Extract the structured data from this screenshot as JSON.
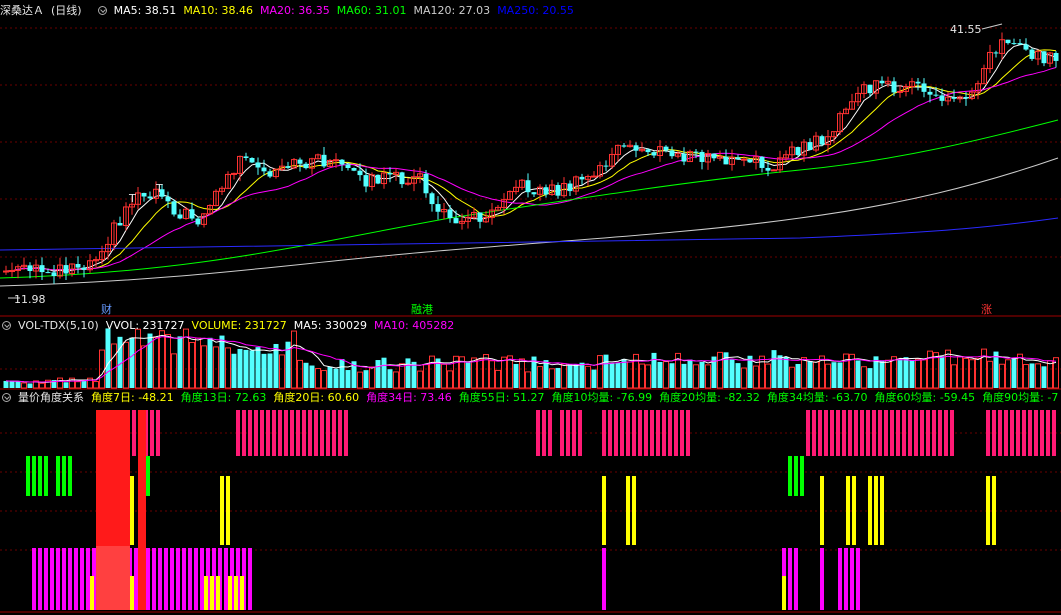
{
  "stock": {
    "name": "深桑达Ａ",
    "period": "(日线)"
  },
  "ma_header": [
    {
      "label": "MA5: 38.51",
      "color": "#ffffff"
    },
    {
      "label": "MA10: 38.46",
      "color": "#ffff00"
    },
    {
      "label": "MA20: 36.35",
      "color": "#ff00ff"
    },
    {
      "label": "MA60: 31.01",
      "color": "#00ff00"
    },
    {
      "label": "MA120: 27.03",
      "color": "#cccccc"
    },
    {
      "label": "MA250: 20.55",
      "color": "#0000ff"
    }
  ],
  "price_marks": {
    "high": "41.55",
    "low": "11.98",
    "tick_T1": "T",
    "tick_T2": "T"
  },
  "event_tags": [
    {
      "label": "财",
      "color": "#6699ff"
    },
    {
      "label": "融港",
      "color": "#00ff00"
    },
    {
      "label": "涨",
      "color": "#ff3333"
    }
  ],
  "vol_header": [
    {
      "label": "VOL-TDX(5,10)",
      "color": "#e6e6e6"
    },
    {
      "label": "VVOL: 231727",
      "color": "#ffffff"
    },
    {
      "label": "VOLUME: 231727",
      "color": "#ffff00"
    },
    {
      "label": "MA5: 330029",
      "color": "#ffffff"
    },
    {
      "label": "MA10: 405282",
      "color": "#ff00ff"
    }
  ],
  "ind_header": [
    {
      "label": "量价角度关系",
      "color": "#e6e6e6"
    },
    {
      "label": "角度7日: -48.21",
      "color": "#ffff00"
    },
    {
      "label": "角度13日: 72.63",
      "color": "#00ff00"
    },
    {
      "label": "角度20日: 60.60",
      "color": "#ffff00"
    },
    {
      "label": "角度34日: 73.46",
      "color": "#ff00ff"
    },
    {
      "label": "角度55日: 51.27",
      "color": "#00ff00"
    },
    {
      "label": "角度10均量: -76.99",
      "color": "#00ff00"
    },
    {
      "label": "角度20均量: -82.32",
      "color": "#00ff00"
    },
    {
      "label": "角度34均量: -63.70",
      "color": "#00ff00"
    },
    {
      "label": "角度60均量: -59.45",
      "color": "#00ff00"
    },
    {
      "label": "角度90均量: -7",
      "color": "#00ff00"
    }
  ],
  "colors": {
    "up": "#ff3232",
    "down": "#54ffff",
    "grid": "#6a0000",
    "border": "#a00000"
  }
}
